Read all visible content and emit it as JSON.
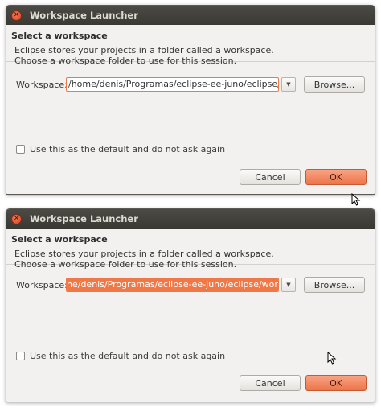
{
  "dialogs": [
    {
      "title": "Workspace Launcher",
      "header_title": "Select a workspace",
      "desc_line1": "Eclipse stores your projects in a folder called a workspace.",
      "desc_line2": "Choose a workspace folder to use for this session.",
      "workspace_label": "Workspace:",
      "workspace_value": "/home/denis/Programas/eclipse-ee-juno/eclipse/work",
      "browse_label": "Browse...",
      "checkbox_label": "Use this as the default and do not ask again",
      "cancel_label": "Cancel",
      "ok_label": "OK"
    },
    {
      "title": "Workspace Launcher",
      "header_title": "Select a workspace",
      "desc_line1": "Eclipse stores your projects in a folder called a workspace.",
      "desc_line2": "Choose a workspace folder to use for this session.",
      "workspace_label": "Workspace:",
      "workspace_value": "ne/denis/Programas/eclipse-ee-juno/eclipse/workspace",
      "browse_label": "Browse...",
      "checkbox_label": "Use this as the default and do not ask again",
      "cancel_label": "Cancel",
      "ok_label": "OK"
    }
  ],
  "colors": {
    "accent": "#f07746",
    "titlebar": "#3c3b37",
    "dialog_bg": "#f2f1f0"
  },
  "icons": {
    "close": "close-icon",
    "dropdown": "chevron-down-icon",
    "cursor": "mouse-pointer-icon"
  }
}
